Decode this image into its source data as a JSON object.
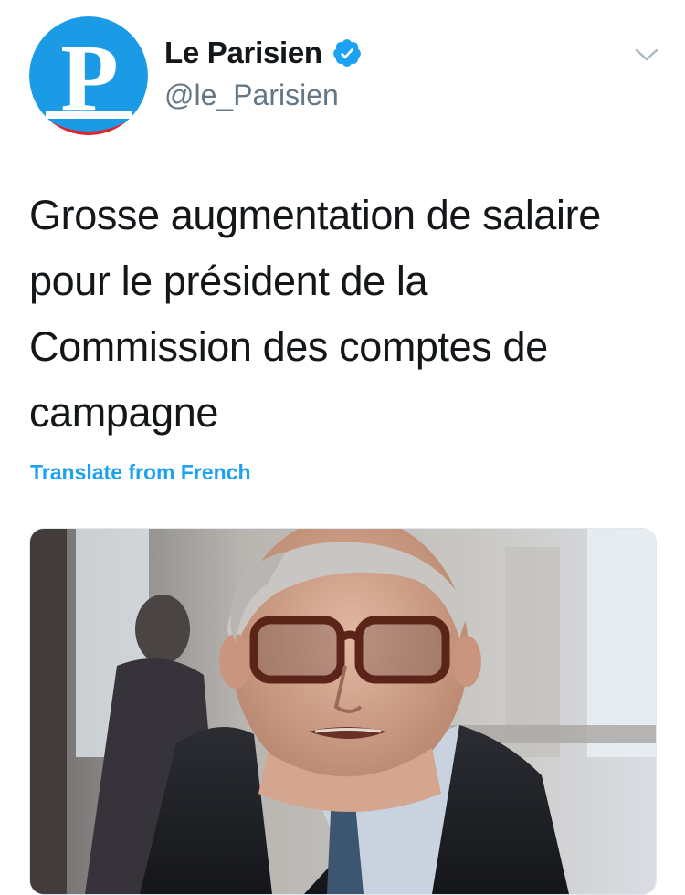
{
  "author": {
    "display_name": "Le Parisien",
    "handle": "@le_Parisien",
    "avatar_letter": "P",
    "verified": true
  },
  "tweet": {
    "text": "Grosse augmentation de salaire pour le président de la Commission des comptes de campagne",
    "translate_label": "Translate from French"
  },
  "icons": {
    "verified": "verified-badge-icon",
    "menu": "chevron-down-icon"
  },
  "colors": {
    "brand_blue": "#1da1f2",
    "avatar_blue": "#1b9ae6",
    "avatar_red": "#e3242b",
    "text_primary": "#14171a",
    "text_secondary": "#657786"
  }
}
